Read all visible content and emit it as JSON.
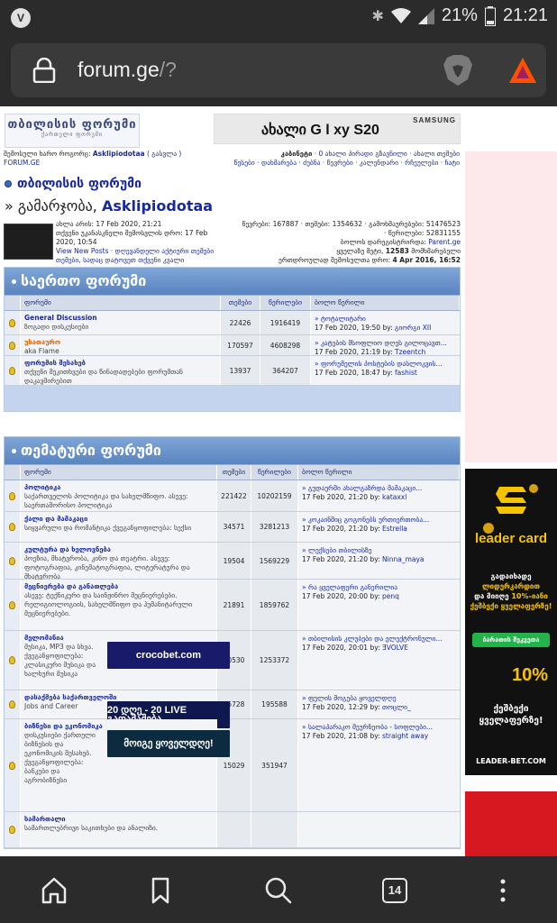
{
  "status": {
    "battery_pct": "21%",
    "time": "21:21"
  },
  "browser": {
    "url_host": "forum.ge",
    "url_rest": "/?",
    "tab_count": "14"
  },
  "header": {
    "logo_text": "თბილისის ფორუმი",
    "logo_sub": "ქართული ფორუმი",
    "banner_text": "ახალი G  l  xy S20",
    "banner_brand": "SAMSUNG"
  },
  "userbar": {
    "left1_pre": "შემოსული ხარო როგორც:",
    "left1_user": "Asklipiodotaa",
    "left1_post": "( გასვლა )",
    "left2": "FORUM.GE",
    "right1_cab": "კაბინეტი",
    "right1_rest": " · 0 ახალი პირადი გზავნილი · ახალი თემები",
    "right2": "წესები · დახმარება · ძებნა · წევრები · კალენდარი · რჩეულები · ჩატი"
  },
  "forum_title": "თბილისის ფორუმი",
  "welcome": {
    "pre": "» გამარჯობა, ",
    "name": "Asklipiodotaa"
  },
  "info": {
    "now": "ახლა არის: 17 Feb 2020, 21:21",
    "last_visit": "თქვენი უკანასკნელი შემოსვლის დრო: 17 Feb 2020, 10:54",
    "view_new": "View New Posts",
    "view_new_rest": " · დღევანდელი აქტიური თემები",
    "your_topics": "თემები, სადაც დატოვეთ თქვენი კვალი",
    "stats1": "წევრები: 167887 · თემები: 1354632 · გამოხმაურებები: 51476523",
    "stats2": "· წერილები: 52831155",
    "last_member_pre": "ბოლოს დარეგისტრირდა: ",
    "last_member": "Parent.ge",
    "online_pre": "ყველაზე მეტი, ",
    "online_num": "12583",
    "online_post": " მომხმარებელი",
    "online_date_pre": "ერთდროულად შემოსულთა დრო: ",
    "online_date": "4 Apr 2016, 16:52"
  },
  "section1": {
    "title": "საერთო ფორუმი",
    "cols": [
      "ფორუმი",
      "თემები",
      "წერილები",
      "ბოლო წერილი"
    ],
    "rows": [
      {
        "name": "General Discussion",
        "desc": "ზოგადი დისკუსიები",
        "topics": "22426",
        "posts": "1916419",
        "last": "» ტოტალიტარი",
        "date": "17 Feb 2020, 19:50 by: ",
        "by": "გიორგი XII",
        "red": false
      },
      {
        "name": "უსათაურო",
        "desc": "aka Flame",
        "topics": "170597",
        "posts": "4608298",
        "last": "» კატების მსოფლიო დღეს გილოცავთ...",
        "date": "17 Feb 2020, 21:19 by: ",
        "by": "Tzeentch",
        "red": true
      },
      {
        "name": "ფორუმის შესახებ",
        "desc": "თქვენი შეკითხვები და წინადადებები ფორუმთან დაკავშირებით",
        "topics": "13937",
        "posts": "364207",
        "last": "» ფორუმელის პოსტების დასლოკვის...",
        "date": "17 Feb 2020, 18:47 by: ",
        "by": "fashist",
        "red": false
      }
    ]
  },
  "section2": {
    "title": "თემატური ფორუმი",
    "cols": [
      "ფორუმი",
      "თემები",
      "წერილები",
      "ბოლო წერილი"
    ],
    "rows": [
      {
        "name": "პოლიტიკა",
        "desc": "საქართველოს პოლიტიკა და სახელმწიფო. ასევე: საერთაშორისო პოლიტიკა",
        "topics": "221422",
        "posts": "10202159",
        "last": "» გუდაურში ახალგაზრდა მამაკაცი...",
        "date": "17 Feb 2020, 21:20 by: ",
        "by": "kataxxl"
      },
      {
        "name": "ქალი და მამაკაცი",
        "desc": "სიყვარული და რომანტიკა ქვეგანყოფილება: სექსი",
        "topics": "34571",
        "posts": "3281213",
        "last": "» კოკაინშიც გოგონებს ურთიერთობა...",
        "date": "17 Feb 2020, 21:20 by: ",
        "by": "Estrella"
      },
      {
        "name": "კულტურა და ხელოვნება",
        "desc": "პოეზია, მხატვრობა, კინო და თეატრი. ასევე: ფოტოგრაფია, კინემატოგრაფია, ლიტერატურა და მხატვრობა",
        "topics": "19504",
        "posts": "1569229",
        "last": "» ლექსები თბილისზე",
        "date": "17 Feb 2020, 21:20 by: ",
        "by": "Ninna_maya"
      },
      {
        "name": "მეცნიერება და განათლება",
        "desc": "ასევე: ტექნიკური და საინჟინრო მეცნიერებები. რელიგიოლოგიის, სახელმწიფო და ჰუმანიტარული მეცნიერებები.",
        "topics": "21891",
        "posts": "1859762",
        "last": "» რა ყველაფერი განერილია",
        "date": "17 Feb 2020, 20:00 by: ",
        "by": "penq"
      },
      {
        "name": "მელომანია",
        "desc": "მუსიკა, MP3 და სხვა. ქვეგანყოფილება: კლასიკური მუსიკა და ხალხური მუსიკა",
        "topics": "20530",
        "posts": "1253372",
        "last": "» თბილისის კლუბები და ელექტრონული...",
        "date": "17 Feb 2020, 20:01 by: ",
        "by": "ƎVOLVE",
        "ad": "crocobet.com",
        "adcolor": "#1a1a6a"
      },
      {
        "name": "დასაქმება საქართველოში",
        "desc": "Jobs and Career",
        "topics": "15728",
        "posts": "195588",
        "last": "» ფულის მოგება ყოველდღე",
        "date": "17 Feb 2020, 12:29 by: ",
        "by": "თოცლი_",
        "ad": "20 დღე - 20 LIVE გათამაშება",
        "adcolor": "#101850"
      },
      {
        "name": "ბიზნესი და ეკონომიკა",
        "desc": "დისკუსიები ქართული ბიზნესის და ეკონომიკის შესახებ. ქვეგანყოფილება: ბანკები და აგრობიზნესი",
        "topics": "15029",
        "posts": "351947",
        "last": "» სალაპარაკო მეურნეობა - სოფლები...",
        "date": "17 Feb 2020, 21:08 by: ",
        "by": "straight away",
        "ad": "მოიგე ყოველდღე!",
        "adcolor": "#0c2a40"
      },
      {
        "name": "სამართალი",
        "desc": "სამართლებრივი საკითხები და ანალიზი.",
        "topics": "",
        "posts": "",
        "last": "",
        "date": "",
        "by": ""
      }
    ]
  },
  "right_ad": {
    "brand": "leader card",
    "line1": "გადაიხადე",
    "line1_y": "ლიდერკარდით",
    "line2_a": "და მიიღე ",
    "line2_b": "10%-იანი",
    "line3_y": "ქეშბექი ყველაფერზე!",
    "button": "ბარათის შეკვეთა",
    "pct": "10%",
    "line4": "ქეშბექი ყველაფერზე!",
    "site": "LEADER-BET.COM"
  }
}
